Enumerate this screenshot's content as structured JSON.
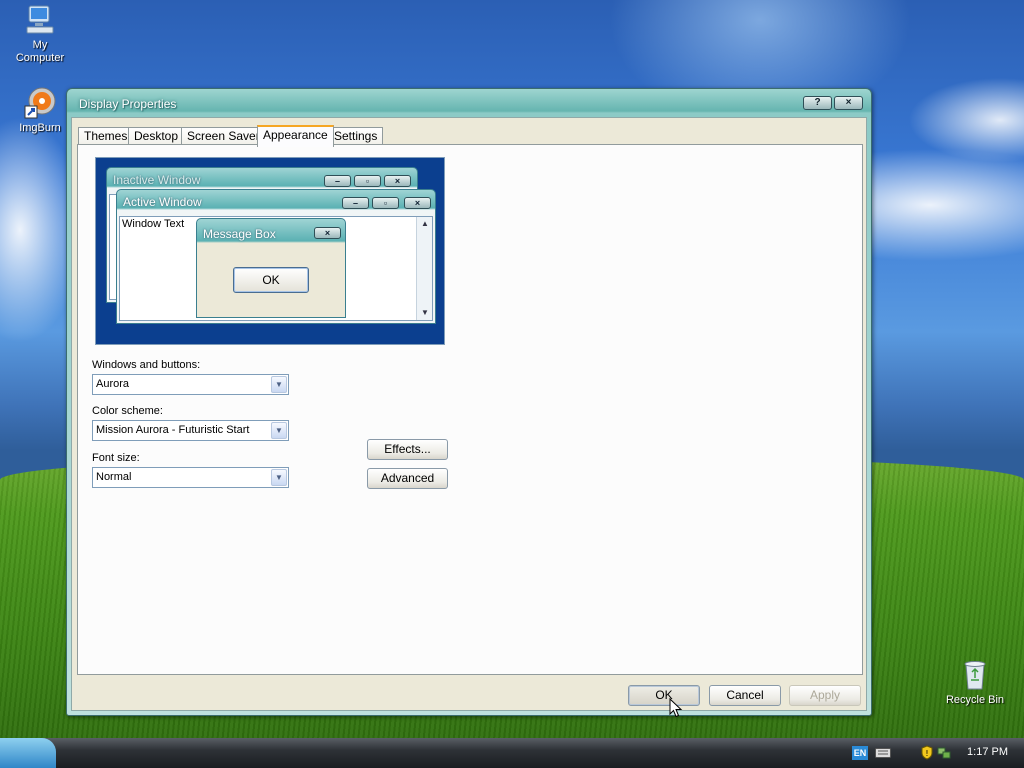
{
  "desktop": {
    "icons": [
      {
        "label": "My\nComputer"
      },
      {
        "label": "ImgBurn"
      },
      {
        "label": "Recycle Bin"
      }
    ]
  },
  "window": {
    "title": "Display Properties",
    "help_label": "?",
    "close_label": "×"
  },
  "tabs": [
    {
      "label": "Themes",
      "active": false
    },
    {
      "label": "Desktop",
      "active": false
    },
    {
      "label": "Screen Saver",
      "active": false
    },
    {
      "label": "Appearance",
      "active": true
    },
    {
      "label": "Settings",
      "active": false
    }
  ],
  "preview": {
    "inactive_title": "Inactive Window",
    "active_title": "Active Window",
    "window_text": "Window Text",
    "message_title": "Message Box",
    "message_ok": "OK"
  },
  "form": {
    "windows_buttons_label": "Windows and buttons:",
    "windows_buttons_value": "Aurora",
    "color_scheme_label": "Color scheme:",
    "color_scheme_value": "Mission Aurora - Futuristic Start",
    "font_size_label": "Font size:",
    "font_size_value": "Normal",
    "effects_label": "Effects...",
    "advanced_label": "Advanced"
  },
  "dialog_buttons": {
    "ok": "OK",
    "cancel": "Cancel",
    "apply": "Apply",
    "apply_disabled": true
  },
  "taskbar": {
    "language": "EN",
    "clock": "1:17 PM"
  },
  "colors": {
    "title_bar": "#66b5b0",
    "dialog_bg": "#ece9d8",
    "active_tab_accent": "#f5a623",
    "preview_bg": "#0b3f8f"
  }
}
